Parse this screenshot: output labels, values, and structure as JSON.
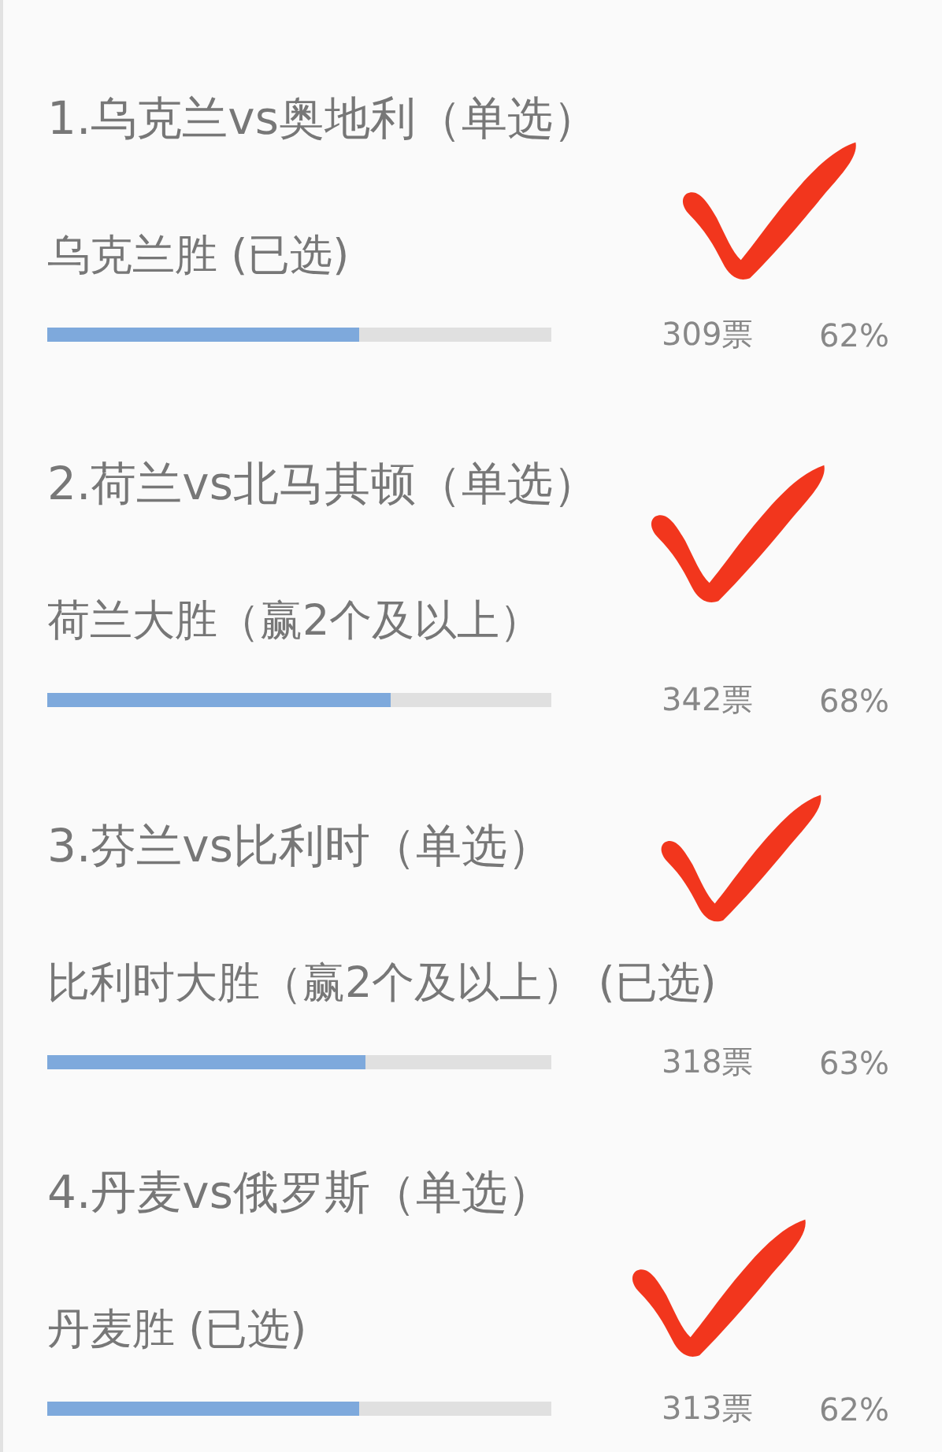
{
  "questions": [
    {
      "title": "1.乌克兰vs奥地利（单选）",
      "option": "乌克兰胜 (已选)",
      "level": 0.62,
      "votes": "309票",
      "percent": "62%",
      "checked": true
    },
    {
      "title": "2.荷兰vs北马其顿（单选）",
      "option": "荷兰大胜（赢2个及以上）",
      "level": 0.68,
      "votes": "342票",
      "percent": "68%",
      "checked": true
    },
    {
      "title": "3.芬兰vs比利时（单选）",
      "option": "比利时大胜（赢2个及以上） (已选)",
      "level": 0.63,
      "votes": "318票",
      "percent": "63%",
      "checked": true
    },
    {
      "title": "4.丹麦vs俄罗斯（单选）",
      "option": "丹麦胜 (已选)",
      "level": 0.62,
      "votes": "313票",
      "percent": "62%",
      "checked": true
    }
  ]
}
